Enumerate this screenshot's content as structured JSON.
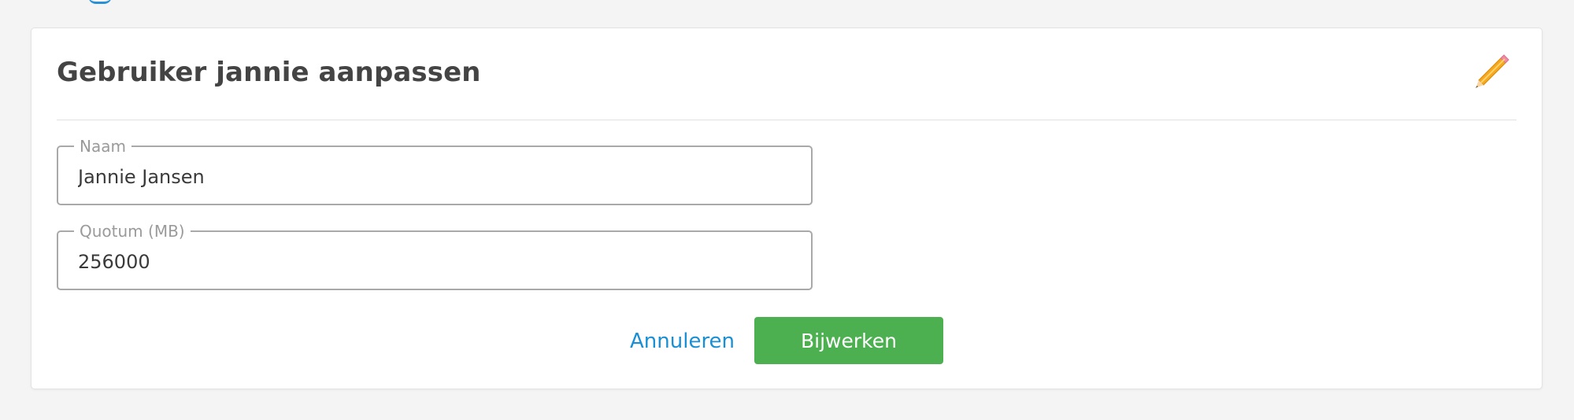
{
  "colors": {
    "page_background": "#f4f4f4",
    "card_background": "#ffffff",
    "title_text": "#444444",
    "field_border": "#a9a9a9",
    "legend_text": "#9a9a9a",
    "link": "#1a8fd3",
    "primary_button": "#4caf50",
    "edit_icon_orange": "#f6a81e",
    "edit_icon_pink": "#f28aa6"
  },
  "card": {
    "title": "Gebruiker jannie aanpassen",
    "header_icon": "pencil-icon"
  },
  "form": {
    "name": {
      "label": "Naam",
      "value": "Jannie Jansen",
      "placeholder": ""
    },
    "quota": {
      "label": "Quotum (MB)",
      "value": "256000",
      "placeholder": ""
    }
  },
  "actions": {
    "cancel_label": "Annuleren",
    "submit_label": "Bijwerken"
  }
}
